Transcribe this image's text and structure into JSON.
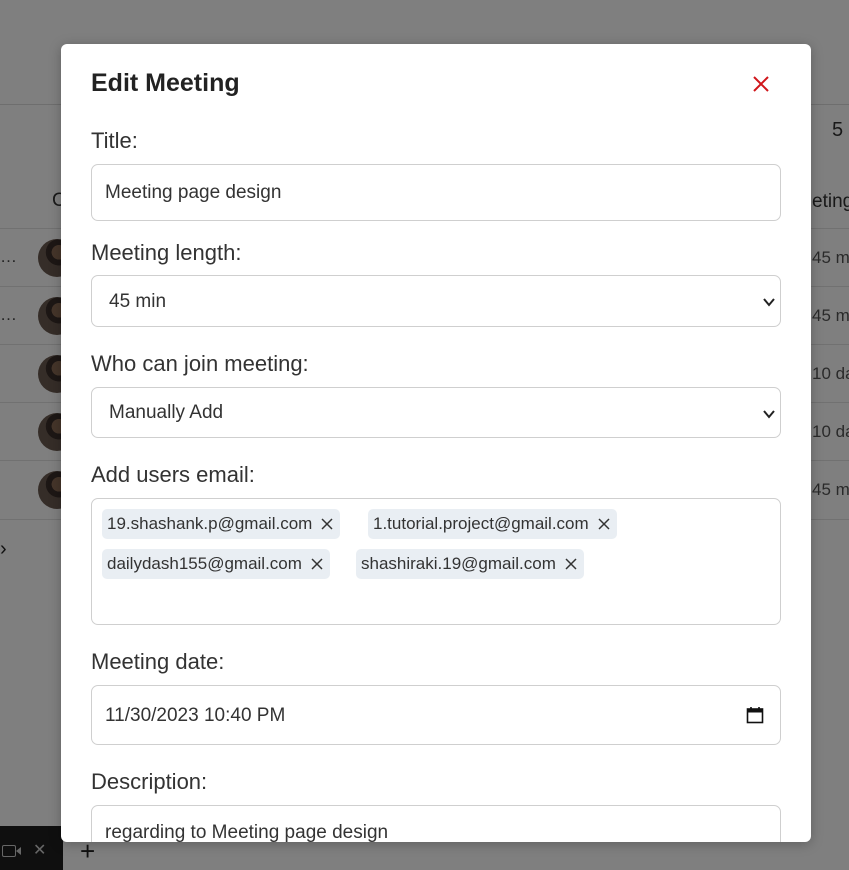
{
  "background": {
    "count_text": "5",
    "col_left_text": "C",
    "col_right_text": "eting",
    "rows": [
      {
        "ellipsis": "…",
        "duration": "45 m"
      },
      {
        "ellipsis": "…",
        "duration": "45 m"
      },
      {
        "ellipsis": "",
        "duration": "10 da"
      },
      {
        "ellipsis": "",
        "duration": "10 da"
      },
      {
        "ellipsis": "",
        "duration": "45 m"
      }
    ],
    "chevron": "›",
    "taskbar_close": "✕",
    "plus": "+"
  },
  "modal": {
    "title": "Edit Meeting",
    "title_label": "Title:",
    "title_value": "Meeting page design",
    "length_label": "Meeting length:",
    "length_value": "45 min",
    "join_label": "Who can join meeting:",
    "join_value": "Manually Add",
    "emails_label": "Add users email:",
    "emails": [
      "19.shashank.p@gmail.com",
      "1.tutorial.project@gmail.com",
      "dailydash155@gmail.com",
      "shashiraki.19@gmail.com"
    ],
    "date_label": "Meeting date:",
    "date_value": "11/30/2023 10:40 PM",
    "description_label": "Description:",
    "description_value": "regarding to Meeting page design"
  },
  "colors": {
    "close_icon": "#d0161b",
    "tag_bg": "#e9eef3",
    "overlay": "rgba(0,0,0,0.5)"
  },
  "icons": {
    "close": "close-icon",
    "tag_remove": "remove-tag-icon",
    "select": "chevron-down-icon",
    "date": "calendar-icon"
  }
}
